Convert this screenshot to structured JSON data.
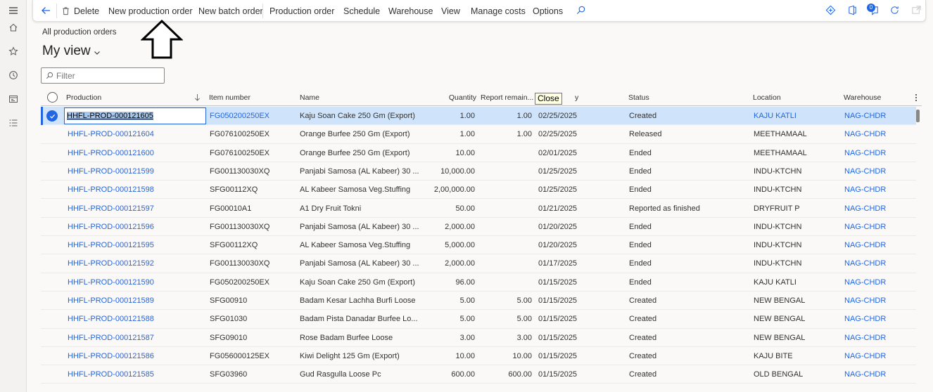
{
  "leftnav": {
    "items": [
      {
        "name": "hamburger-menu-icon"
      },
      {
        "name": "home-icon"
      },
      {
        "name": "favorites-star-icon"
      },
      {
        "name": "recent-clock-icon"
      },
      {
        "name": "workspaces-icon"
      },
      {
        "name": "modules-list-icon"
      }
    ]
  },
  "toolbar": {
    "delete_label": "Delete",
    "new_production_order_label": "New production order",
    "new_batch_order_label": "New batch order",
    "production_order_label": "Production order",
    "schedule_label": "Schedule",
    "warehouse_label": "Warehouse",
    "view_label": "View",
    "manage_costs_label": "Manage costs",
    "options_label": "Options",
    "notification_count": "0"
  },
  "page": {
    "breadcrumb": "All production orders",
    "view_name": "My view",
    "filter_placeholder": "Filter",
    "tooltip": "Close"
  },
  "grid": {
    "columns": {
      "production": "Production",
      "item_number": "Item number",
      "name": "Name",
      "quantity": "Quantity",
      "report_remain": "Report remain...",
      "delivery": "y",
      "status": "Status",
      "location": "Location",
      "warehouse": "Warehouse"
    },
    "rows": [
      {
        "production": "HHFL-PROD-000121605",
        "item": "FG050200250EX",
        "name": "Kaju Soan Cake 250 Gm (Export)",
        "qty": "1.00",
        "remain": "1.00",
        "date": "02/25/2025",
        "status": "Created",
        "location": "KAJU KATLI",
        "warehouse": "NAG-CHDR"
      },
      {
        "production": "HHFL-PROD-000121604",
        "item": "FG076100250EX",
        "name": "Orange Burfee 250 Gm (Export)",
        "qty": "1.00",
        "remain": "1.00",
        "date": "02/25/2025",
        "status": "Released",
        "location": "MEETHAMAAL",
        "warehouse": "NAG-CHDR"
      },
      {
        "production": "HHFL-PROD-000121600",
        "item": "FG076100250EX",
        "name": "Orange Burfee 250 Gm (Export)",
        "qty": "10.00",
        "remain": "",
        "date": "02/01/2025",
        "status": "Ended",
        "location": "MEETHAMAAL",
        "warehouse": "NAG-CHDR"
      },
      {
        "production": "HHFL-PROD-000121599",
        "item": "FG001130030XQ",
        "name": "Panjabi Samosa (AL Kabeer) 30 ...",
        "qty": "10,000.00",
        "remain": "",
        "date": "01/25/2025",
        "status": "Ended",
        "location": "INDU-KTCHN",
        "warehouse": "NAG-CHDR"
      },
      {
        "production": "HHFL-PROD-000121598",
        "item": "SFG00112XQ",
        "name": "AL Kabeer Samosa Veg.Stuffing",
        "qty": "2,00,000.00",
        "remain": "",
        "date": "01/25/2025",
        "status": "Ended",
        "location": "INDU-KTCHN",
        "warehouse": "NAG-CHDR"
      },
      {
        "production": "HHFL-PROD-000121597",
        "item": "FG00010A1",
        "name": "A1 Dry Fruit Tokni",
        "qty": "50.00",
        "remain": "",
        "date": "01/21/2025",
        "status": "Reported as finished",
        "location": "DRYFRUIT P",
        "warehouse": "NAG-CHDR"
      },
      {
        "production": "HHFL-PROD-000121596",
        "item": "FG001130030XQ",
        "name": "Panjabi Samosa (AL Kabeer) 30 ...",
        "qty": "2,000.00",
        "remain": "",
        "date": "01/20/2025",
        "status": "Ended",
        "location": "INDU-KTCHN",
        "warehouse": "NAG-CHDR"
      },
      {
        "production": "HHFL-PROD-000121595",
        "item": "SFG00112XQ",
        "name": "AL Kabeer Samosa Veg.Stuffing",
        "qty": "5,000.00",
        "remain": "",
        "date": "01/20/2025",
        "status": "Ended",
        "location": "INDU-KTCHN",
        "warehouse": "NAG-CHDR"
      },
      {
        "production": "HHFL-PROD-000121592",
        "item": "FG001130030XQ",
        "name": "Panjabi Samosa (AL Kabeer) 30 ...",
        "qty": "2,000.00",
        "remain": "",
        "date": "01/17/2025",
        "status": "Ended",
        "location": "INDU-KTCHN",
        "warehouse": "NAG-CHDR"
      },
      {
        "production": "HHFL-PROD-000121590",
        "item": "FG050200250EX",
        "name": "Kaju Soan Cake 250 Gm (Export)",
        "qty": "96.00",
        "remain": "",
        "date": "01/15/2025",
        "status": "Ended",
        "location": "KAJU KATLI",
        "warehouse": "NAG-CHDR"
      },
      {
        "production": "HHFL-PROD-000121589",
        "item": "SFG00910",
        "name": "Badam Kesar Lachha Burfi Loose",
        "qty": "5.00",
        "remain": "5.00",
        "date": "01/15/2025",
        "status": "Created",
        "location": "NEW BENGAL",
        "warehouse": "NAG-CHDR"
      },
      {
        "production": "HHFL-PROD-000121588",
        "item": "SFG01030",
        "name": "Badam Pista Danadar Burfee Lo...",
        "qty": "5.00",
        "remain": "5.00",
        "date": "01/15/2025",
        "status": "Created",
        "location": "NEW BENGAL",
        "warehouse": "NAG-CHDR"
      },
      {
        "production": "HHFL-PROD-000121587",
        "item": "SFG09010",
        "name": "Rose Badam Burfee Loose",
        "qty": "3.00",
        "remain": "3.00",
        "date": "01/15/2025",
        "status": "Created",
        "location": "NEW BENGAL",
        "warehouse": "NAG-CHDR"
      },
      {
        "production": "HHFL-PROD-000121586",
        "item": "FG056000125EX",
        "name": "Kiwi Delight 125 Gm (Export)",
        "qty": "10.00",
        "remain": "10.00",
        "date": "01/15/2025",
        "status": "Created",
        "location": "KAJU BITE",
        "warehouse": "NAG-CHDR"
      },
      {
        "production": "HHFL-PROD-000121585",
        "item": "SFG03960",
        "name": "Gud Rasgulla Loose Pc",
        "qty": "600.00",
        "remain": "600.00",
        "date": "01/15/2025",
        "status": "Created",
        "location": "OLD BENGAL",
        "warehouse": "NAG-CHDR"
      }
    ]
  },
  "colors": {
    "accent": "#2266e3",
    "selected_row": "#cfe4fa",
    "tooltip_bg": "#ffffe1"
  }
}
